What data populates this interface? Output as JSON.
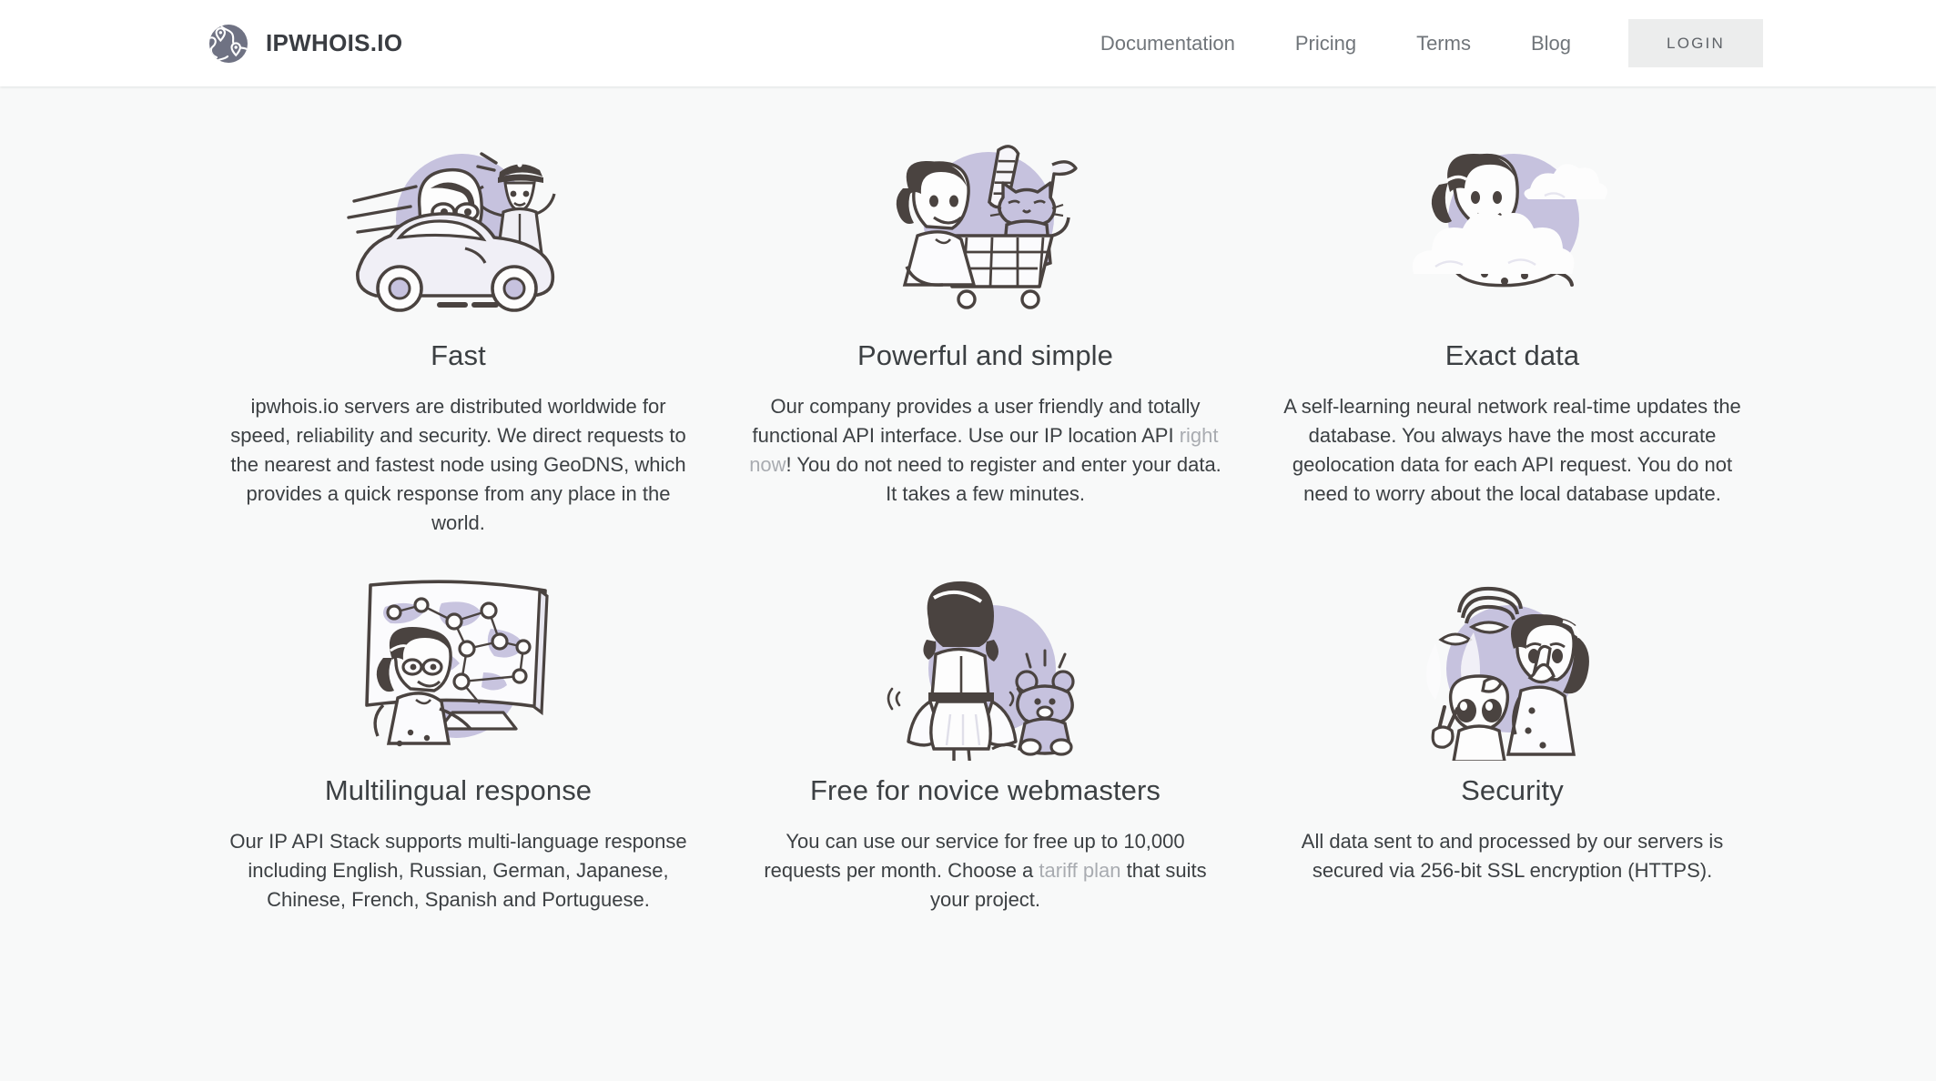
{
  "header": {
    "logo_icon": "globe-map-pins-icon",
    "brand_name": "IPWHOIS.IO",
    "nav": [
      {
        "label": "Documentation",
        "name": "documentation"
      },
      {
        "label": "Pricing",
        "name": "pricing"
      },
      {
        "label": "Terms",
        "name": "terms"
      },
      {
        "label": "Blog",
        "name": "blog"
      }
    ],
    "login_label": "LOGIN"
  },
  "colors": {
    "page_background": "#f8f9f9",
    "header_background": "#ffffff",
    "text": "#3c4043",
    "muted_text": "#70757a",
    "link": "#a9acb1",
    "button_background": "#eceded",
    "illustration_accent": "#c6c2de",
    "illustration_ink": "#4a4340"
  },
  "features": [
    {
      "id": "fast",
      "illustration": "woman-driving-sports-car-with-police-officer-illustration",
      "title": "Fast",
      "text_before": "ipwhois.io servers are distributed worldwide for speed, reliability and security. We direct requests to the nearest and fastest node using GeoDNS, which provides a quick response from any place in the world.",
      "link_text": "",
      "text_after": ""
    },
    {
      "id": "powerful-and-simple",
      "illustration": "woman-with-shopping-cart-cat-bread-illustration",
      "title": "Powerful and simple",
      "text_before": "Our company provides a user friendly and totally functional API interface. Use our IP location API ",
      "link_text": "right now",
      "text_after": "! You do not need to register and enter your data. It takes a few minutes."
    },
    {
      "id": "exact-data",
      "illustration": "woman-reclining-on-cloud-illustration",
      "title": "Exact data",
      "text_before": "A self-learning neural network real-time updates the database. You always have the most accurate geolocation data for each API request. You do not need to worry about the local database update.",
      "link_text": "",
      "text_after": ""
    },
    {
      "id": "multilingual-response",
      "illustration": "woman-at-screen-with-world-map-network-illustration",
      "title": "Multilingual response",
      "text_before": "Our IP API Stack supports multi-language response including English, Russian, German, Japanese, Chinese, French, Spanish and Portuguese.",
      "link_text": "",
      "text_after": ""
    },
    {
      "id": "free-for-novice-webmasters",
      "illustration": "woman-curtseying-with-teddy-bear-illustration",
      "title": "Free for novice webmasters",
      "text_before": "You can use our service for free up to 10,000 requests per month. Choose a ",
      "link_text": "tariff plan",
      "text_after": " that suits your project."
    },
    {
      "id": "security",
      "illustration": "woman-shushing-with-alien-illustration",
      "title": "Security",
      "text_before": "All data sent to and processed by our servers is secured via 256-bit SSL encryption (HTTPS).",
      "link_text": "",
      "text_after": ""
    }
  ]
}
